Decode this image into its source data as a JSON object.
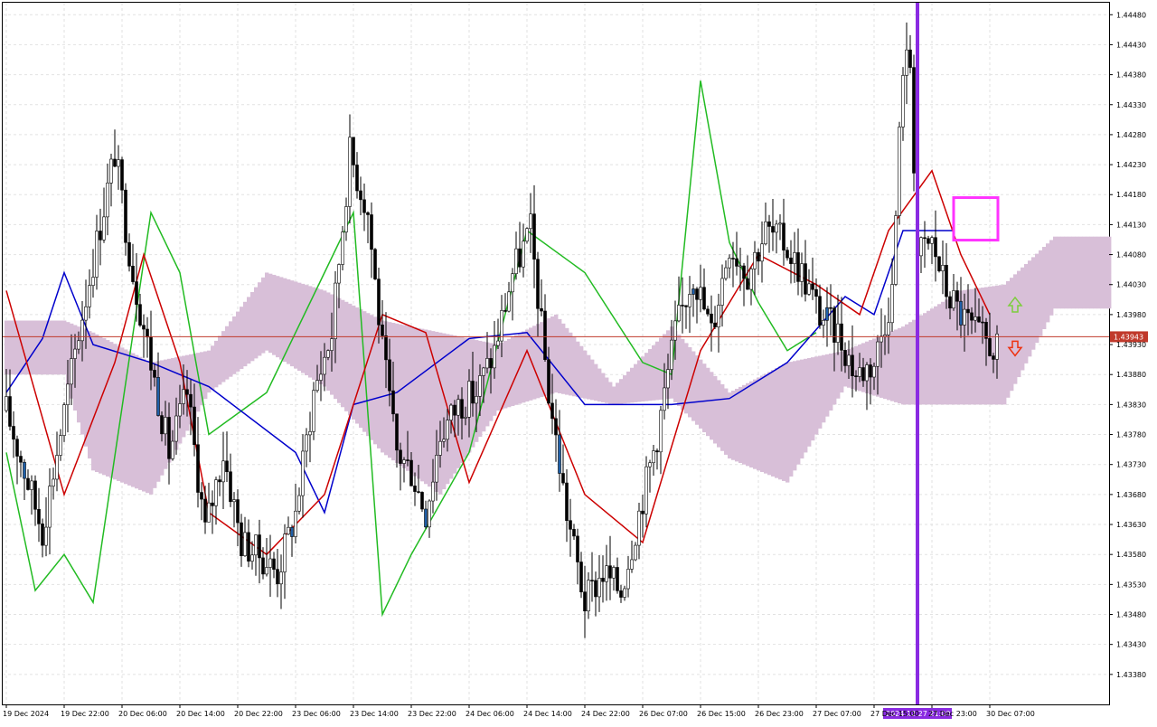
{
  "chart_data": {
    "type": "candlestick",
    "instrument_note": "",
    "ylim": [
      1.4333,
      1.445
    ],
    "y_ticks": [
      "1.44480",
      "1.44430",
      "1.44380",
      "1.44330",
      "1.44280",
      "1.44230",
      "1.44180",
      "1.44130",
      "1.44080",
      "1.44030",
      "1.43980",
      "1.43930",
      "1.43880",
      "1.43830",
      "1.43780",
      "1.43730",
      "1.43680",
      "1.43630",
      "1.43580",
      "1.43530",
      "1.43480",
      "1.43430",
      "1.43380"
    ],
    "x_ticks": [
      {
        "i": 0,
        "label": "19 Dec 2024"
      },
      {
        "i": 16,
        "label": "19 Dec 22:00"
      },
      {
        "i": 32,
        "label": "20 Dec 06:00"
      },
      {
        "i": 48,
        "label": "20 Dec 14:00"
      },
      {
        "i": 64,
        "label": "20 Dec 22:00"
      },
      {
        "i": 80,
        "label": "23 Dec 06:00"
      },
      {
        "i": 96,
        "label": "23 Dec 14:00"
      },
      {
        "i": 112,
        "label": "23 Dec 22:00"
      },
      {
        "i": 128,
        "label": "24 Dec 06:00"
      },
      {
        "i": 144,
        "label": "24 Dec 14:00"
      },
      {
        "i": 160,
        "label": "24 Dec 22:00"
      },
      {
        "i": 176,
        "label": "26 Dec 07:00"
      },
      {
        "i": 192,
        "label": "26 Dec 15:00"
      },
      {
        "i": 208,
        "label": "26 Dec 23:00"
      },
      {
        "i": 224,
        "label": "27 Dec 07:00"
      },
      {
        "i": 240,
        "label": "27 Dec 15:00"
      },
      {
        "i": 256,
        "label": "27 Dec 23:00"
      },
      {
        "i": 272,
        "label": "30 Dec 07:00"
      }
    ],
    "current_price": "1.43943",
    "current_price_value": 1.43943,
    "vertical_marker": {
      "i": 252,
      "label": "2024.12.27 21:00"
    },
    "colors": {
      "bull_body": "#ffffff",
      "bear_body": "#000000",
      "highlight_body": "#1f5fa8",
      "wick": "#000000",
      "tenkan": "#0000cc",
      "kijun": "#cc0000",
      "chikou": "#22bb22",
      "cloud_up": "#f4a460",
      "cloud_down": "#d8bfd8",
      "price_line": "#c0392b",
      "marker_line": "#8a2be2",
      "box": "#ff33ff",
      "arrow_up": "#7ccd3c",
      "arrow_down": "#ee3311"
    },
    "points": [
      [
        0,
        1.4382
      ],
      [
        10,
        1.4362
      ],
      [
        20,
        1.4395
      ],
      [
        30,
        1.4425
      ],
      [
        35,
        1.4405
      ],
      [
        40,
        1.439
      ],
      [
        45,
        1.4375
      ],
      [
        50,
        1.4385
      ],
      [
        55,
        1.4362
      ],
      [
        60,
        1.4375
      ],
      [
        65,
        1.436
      ],
      [
        70,
        1.4358
      ],
      [
        75,
        1.4355
      ],
      [
        80,
        1.4365
      ],
      [
        85,
        1.4385
      ],
      [
        90,
        1.4395
      ],
      [
        95,
        1.4425
      ],
      [
        100,
        1.4415
      ],
      [
        104,
        1.4392
      ],
      [
        108,
        1.4375
      ],
      [
        112,
        1.4372
      ],
      [
        116,
        1.4365
      ],
      [
        120,
        1.4378
      ],
      [
        125,
        1.4383
      ],
      [
        130,
        1.4385
      ],
      [
        135,
        1.4392
      ],
      [
        140,
        1.4405
      ],
      [
        145,
        1.4412
      ],
      [
        150,
        1.4385
      ],
      [
        155,
        1.4365
      ],
      [
        160,
        1.435
      ],
      [
        165,
        1.4355
      ],
      [
        170,
        1.4352
      ],
      [
        175,
        1.4365
      ],
      [
        180,
        1.4378
      ],
      [
        185,
        1.4395
      ],
      [
        190,
        1.4405
      ],
      [
        195,
        1.4395
      ],
      [
        200,
        1.441
      ],
      [
        205,
        1.4405
      ],
      [
        210,
        1.4412
      ],
      [
        215,
        1.441
      ],
      [
        220,
        1.4405
      ],
      [
        225,
        1.4398
      ],
      [
        230,
        1.4395
      ],
      [
        235,
        1.4388
      ],
      [
        240,
        1.439
      ],
      [
        245,
        1.4402
      ],
      [
        248,
        1.444
      ],
      [
        250,
        1.444
      ],
      [
        252,
        1.4408
      ],
      [
        256,
        1.441
      ],
      [
        260,
        1.4402
      ],
      [
        264,
        1.4398
      ],
      [
        268,
        1.4395
      ],
      [
        272,
        1.4393
      ],
      [
        274,
        1.4392
      ]
    ],
    "n_bars": 275,
    "tenkan": [
      [
        0,
        1.4385
      ],
      [
        10,
        1.4394
      ],
      [
        16,
        1.4405
      ],
      [
        24,
        1.4393
      ],
      [
        40,
        1.439
      ],
      [
        56,
        1.4386
      ],
      [
        80,
        1.4375
      ],
      [
        88,
        1.4365
      ],
      [
        96,
        1.4383
      ],
      [
        108,
        1.4385
      ],
      [
        128,
        1.4394
      ],
      [
        144,
        1.4395
      ],
      [
        160,
        1.4383
      ],
      [
        184,
        1.4383
      ],
      [
        200,
        1.4384
      ],
      [
        216,
        1.439
      ],
      [
        232,
        1.4401
      ],
      [
        240,
        1.4398
      ],
      [
        248,
        1.4412
      ],
      [
        262,
        1.4412
      ]
    ],
    "kijun": [
      [
        0,
        1.4402
      ],
      [
        16,
        1.4368
      ],
      [
        30,
        1.439
      ],
      [
        38,
        1.4408
      ],
      [
        48,
        1.439
      ],
      [
        56,
        1.4365
      ],
      [
        72,
        1.4358
      ],
      [
        88,
        1.4368
      ],
      [
        104,
        1.4398
      ],
      [
        116,
        1.4395
      ],
      [
        128,
        1.437
      ],
      [
        144,
        1.4392
      ],
      [
        160,
        1.4368
      ],
      [
        176,
        1.436
      ],
      [
        192,
        1.4392
      ],
      [
        208,
        1.4408
      ],
      [
        224,
        1.4403
      ],
      [
        236,
        1.4398
      ],
      [
        244,
        1.4412
      ],
      [
        256,
        1.4422
      ],
      [
        264,
        1.4408
      ],
      [
        272,
        1.4398
      ]
    ],
    "chikou": [
      [
        0,
        1.4375
      ],
      [
        8,
        1.4352
      ],
      [
        16,
        1.4358
      ],
      [
        24,
        1.435
      ],
      [
        40,
        1.4415
      ],
      [
        48,
        1.4405
      ],
      [
        56,
        1.4378
      ],
      [
        72,
        1.4385
      ],
      [
        88,
        1.4405
      ],
      [
        96,
        1.4415
      ],
      [
        104,
        1.4348
      ],
      [
        112,
        1.4358
      ],
      [
        128,
        1.4375
      ],
      [
        144,
        1.4412
      ],
      [
        160,
        1.4405
      ],
      [
        176,
        1.439
      ],
      [
        184,
        1.4388
      ],
      [
        192,
        1.4437
      ],
      [
        200,
        1.441
      ],
      [
        208,
        1.44
      ],
      [
        216,
        1.4392
      ],
      [
        224,
        1.4395
      ]
    ],
    "cloud_spans": [
      [
        16,
        1.4388,
        1.4397
      ],
      [
        24,
        1.4372,
        1.4395
      ],
      [
        40,
        1.4368,
        1.439
      ],
      [
        56,
        1.4385,
        1.4392
      ],
      [
        72,
        1.4392,
        1.4405
      ],
      [
        88,
        1.4386,
        1.4402
      ],
      [
        104,
        1.4375,
        1.4397
      ],
      [
        120,
        1.4368,
        1.4395
      ],
      [
        136,
        1.4382,
        1.4393
      ],
      [
        152,
        1.4385,
        1.4398
      ],
      [
        168,
        1.4383,
        1.4386
      ],
      [
        184,
        1.4384,
        1.4396
      ],
      [
        200,
        1.4374,
        1.4385
      ],
      [
        216,
        1.437,
        1.439
      ],
      [
        232,
        1.4386,
        1.4392
      ],
      [
        248,
        1.4383,
        1.4396
      ],
      [
        264,
        1.4383,
        1.4402
      ],
      [
        276,
        1.4383,
        1.4403
      ],
      [
        290,
        1.4399,
        1.4411
      ]
    ]
  }
}
